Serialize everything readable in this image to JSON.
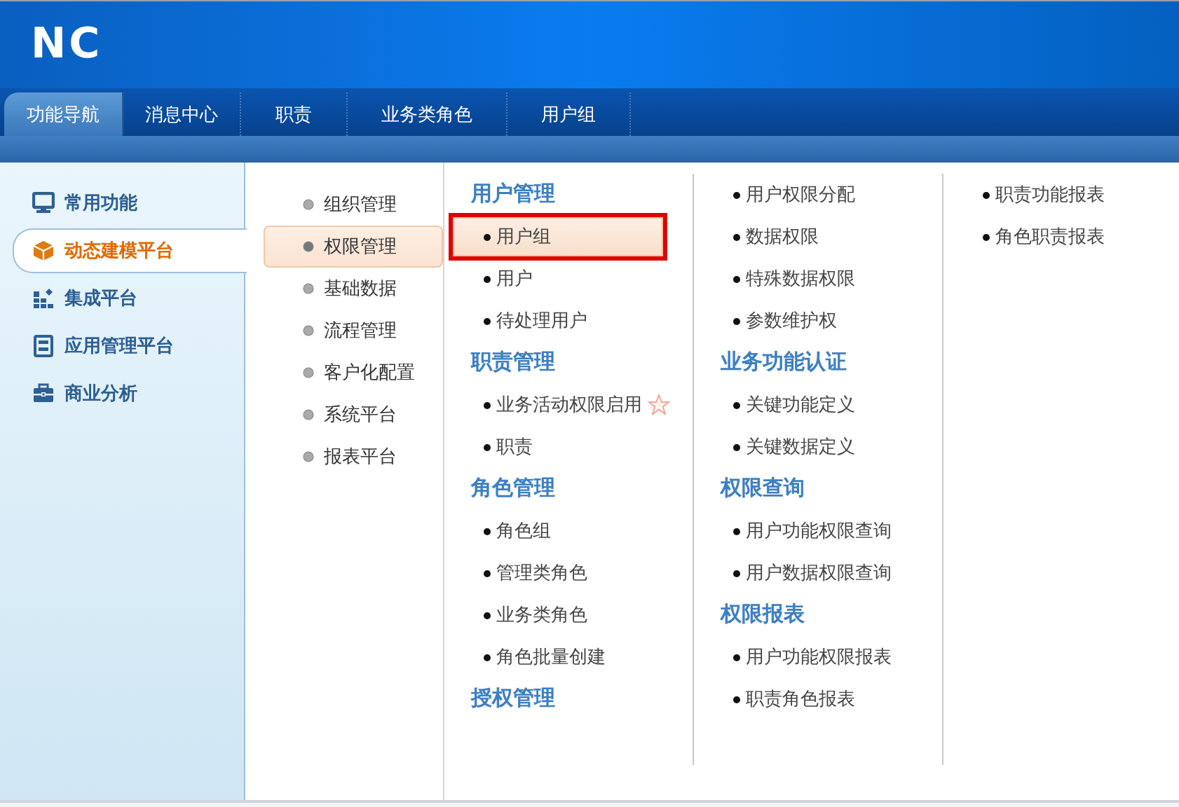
{
  "logo": "NC",
  "tabs": [
    {
      "label": "功能导航",
      "selected": true
    },
    {
      "label": "消息中心",
      "selected": false
    },
    {
      "label": "职责",
      "selected": false
    },
    {
      "label": "业务类角色",
      "selected": false
    },
    {
      "label": "用户组",
      "selected": false
    }
  ],
  "sidebar": {
    "items": [
      {
        "label": "常用功能",
        "selected": false
      },
      {
        "label": "动态建模平台",
        "selected": true
      },
      {
        "label": "集成平台",
        "selected": false
      },
      {
        "label": "应用管理平台",
        "selected": false
      },
      {
        "label": "商业分析",
        "selected": false
      }
    ]
  },
  "categories": [
    {
      "label": "组织管理",
      "selected": false
    },
    {
      "label": "权限管理",
      "selected": true
    },
    {
      "label": "基础数据",
      "selected": false
    },
    {
      "label": "流程管理",
      "selected": false
    },
    {
      "label": "客户化配置",
      "selected": false
    },
    {
      "label": "系统平台",
      "selected": false
    },
    {
      "label": "报表平台",
      "selected": false
    }
  ],
  "menu_columns": [
    [
      {
        "kind": "heading",
        "label": "用户管理"
      },
      {
        "kind": "item",
        "label": "用户组",
        "selected": true,
        "outlined": true,
        "starred": false
      },
      {
        "kind": "item",
        "label": "用户",
        "selected": false,
        "outlined": false,
        "starred": false
      },
      {
        "kind": "item",
        "label": "待处理用户",
        "selected": false,
        "outlined": false,
        "starred": false
      },
      {
        "kind": "heading",
        "label": "职责管理"
      },
      {
        "kind": "item",
        "label": "业务活动权限启用",
        "selected": false,
        "outlined": false,
        "starred": true
      },
      {
        "kind": "item",
        "label": "职责",
        "selected": false,
        "outlined": false,
        "starred": false
      },
      {
        "kind": "heading",
        "label": "角色管理"
      },
      {
        "kind": "item",
        "label": "角色组",
        "selected": false,
        "outlined": false,
        "starred": false
      },
      {
        "kind": "item",
        "label": "管理类角色",
        "selected": false,
        "outlined": false,
        "starred": false
      },
      {
        "kind": "item",
        "label": "业务类角色",
        "selected": false,
        "outlined": false,
        "starred": false
      },
      {
        "kind": "item",
        "label": "角色批量创建",
        "selected": false,
        "outlined": false,
        "starred": false
      },
      {
        "kind": "heading",
        "label": "授权管理"
      }
    ],
    [
      {
        "kind": "item",
        "label": "用户权限分配",
        "selected": false,
        "outlined": false,
        "starred": false
      },
      {
        "kind": "item",
        "label": "数据权限",
        "selected": false,
        "outlined": false,
        "starred": false
      },
      {
        "kind": "item",
        "label": "特殊数据权限",
        "selected": false,
        "outlined": false,
        "starred": false
      },
      {
        "kind": "item",
        "label": "参数维护权",
        "selected": false,
        "outlined": false,
        "starred": false
      },
      {
        "kind": "heading",
        "label": "业务功能认证"
      },
      {
        "kind": "item",
        "label": "关键功能定义",
        "selected": false,
        "outlined": false,
        "starred": false
      },
      {
        "kind": "item",
        "label": "关键数据定义",
        "selected": false,
        "outlined": false,
        "starred": false
      },
      {
        "kind": "heading",
        "label": "权限查询"
      },
      {
        "kind": "item",
        "label": "用户功能权限查询",
        "selected": false,
        "outlined": false,
        "starred": false
      },
      {
        "kind": "item",
        "label": "用户数据权限查询",
        "selected": false,
        "outlined": false,
        "starred": false
      },
      {
        "kind": "heading",
        "label": "权限报表"
      },
      {
        "kind": "item",
        "label": "用户功能权限报表",
        "selected": false,
        "outlined": false,
        "starred": false
      },
      {
        "kind": "item",
        "label": "职责角色报表",
        "selected": false,
        "outlined": false,
        "starred": false
      }
    ],
    [
      {
        "kind": "item",
        "label": "职责功能报表",
        "selected": false,
        "outlined": false,
        "starred": false
      },
      {
        "kind": "item",
        "label": "角色职责报表",
        "selected": false,
        "outlined": false,
        "starred": false
      }
    ]
  ]
}
